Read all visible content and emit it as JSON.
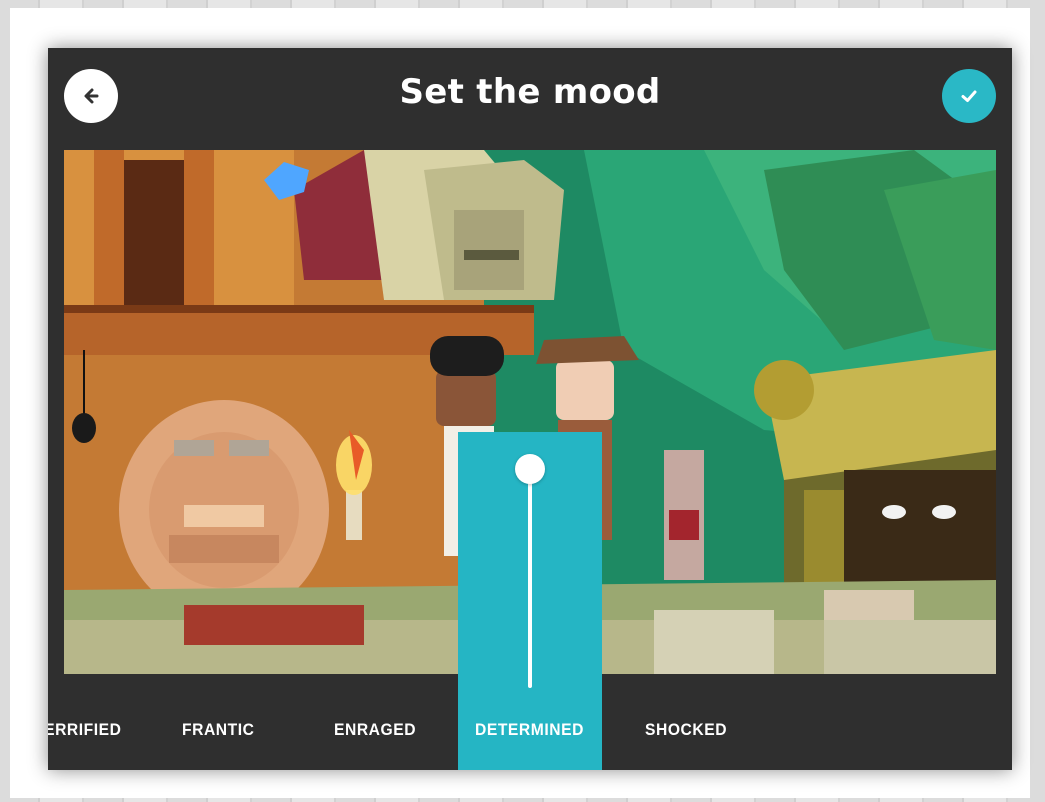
{
  "header": {
    "title": "Set the mood",
    "back_icon": "arrow-left-icon",
    "confirm_icon": "check-icon",
    "accent_color": "#2ab8c6"
  },
  "moods": {
    "items": [
      "TERRIFIED",
      "FRANTIC",
      "ENRAGED",
      "DETERMINED",
      "SHOCKED"
    ],
    "selected": "DETERMINED"
  },
  "slider": {
    "level": 1.0
  },
  "colors": {
    "dialog_bg": "#2f2f2f",
    "accent": "#25b5c4",
    "text": "#ffffff"
  }
}
